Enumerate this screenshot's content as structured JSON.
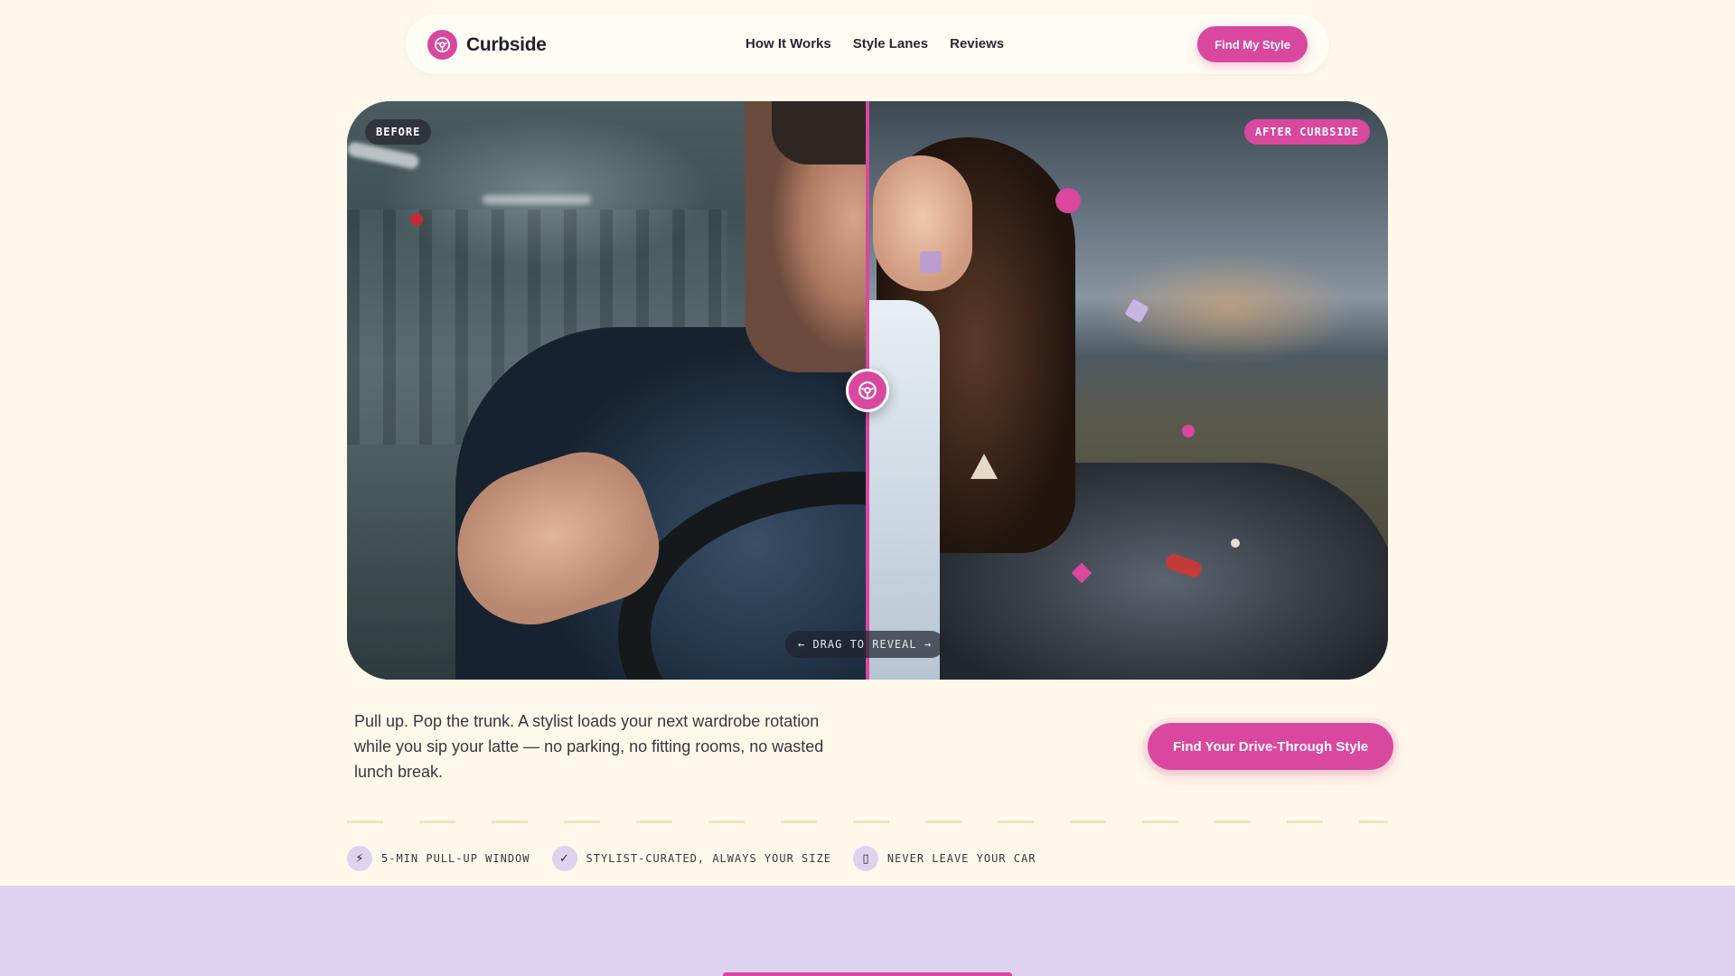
{
  "nav": {
    "brand": "Curbside",
    "links": [
      "How It Works",
      "Style Lanes",
      "Reviews"
    ],
    "cta": "Find My Style"
  },
  "hero": {
    "before_tag": "BEFORE",
    "after_tag": "AFTER CURBSIDE",
    "drag_hint": "← DRAG TO REVEAL →",
    "split_fraction": 0.5
  },
  "tagline": "Pull up. Pop the trunk. A stylist loads your next wardrobe rotation while you sip your latte — no parking, no fitting rooms, no wasted lunch break.",
  "hero_cta": "Find Your Drive-Through Style",
  "features": [
    {
      "icon": "lightning-icon",
      "glyph": "⚡",
      "label": "5-MIN PULL-UP WINDOW"
    },
    {
      "icon": "check-icon",
      "glyph": "✓",
      "label": "STYLIST-CURATED, ALWAYS YOUR SIZE"
    },
    {
      "icon": "car-icon",
      "glyph": "▯",
      "label": "NEVER LEAVE YOUR CAR"
    }
  ],
  "colors": {
    "accent": "#d9479f",
    "background": "#fef8ea",
    "lavender": "#ddd2ef"
  }
}
